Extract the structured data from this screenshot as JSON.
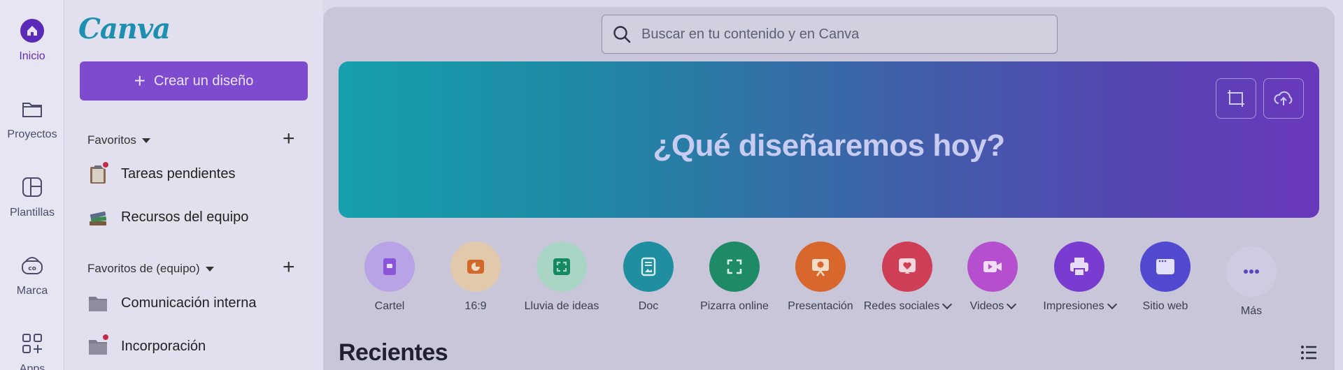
{
  "rail": {
    "items": [
      {
        "label": "Inicio",
        "icon": "home-icon",
        "active": true
      },
      {
        "label": "Proyectos",
        "icon": "folder-icon"
      },
      {
        "label": "Plantillas",
        "icon": "templates-icon"
      },
      {
        "label": "Marca",
        "icon": "brand-icon"
      },
      {
        "label": "Apps",
        "icon": "apps-icon"
      }
    ]
  },
  "sidebar": {
    "logo": "Canva",
    "create_label": "Crear un diseño",
    "favorites": {
      "title": "Favoritos",
      "items": [
        {
          "label": "Tareas pendientes",
          "icon": "clipboard-icon"
        },
        {
          "label": "Recursos del equipo",
          "icon": "books-icon"
        }
      ]
    },
    "team_favorites": {
      "title": "Favoritos de (equipo)",
      "items": [
        {
          "label": "Comunicación interna",
          "icon": "folder-icon"
        },
        {
          "label": "Incorporación",
          "icon": "folder-icon"
        }
      ]
    }
  },
  "main": {
    "search_placeholder": "Buscar en tu contenido y en Canva",
    "banner_title": "¿Qué diseñaremos hoy?",
    "design_types": [
      {
        "label": "Cartel",
        "color": "#b7a3e6",
        "icon": "poster-icon"
      },
      {
        "label": "16:9",
        "color": "#e3c9ab",
        "icon": "pie-icon"
      },
      {
        "label": "Lluvia de ideas",
        "color": "#a9d6c4",
        "icon": "brainstorm-icon"
      },
      {
        "label": "Doc",
        "color": "#1f8ea0",
        "icon": "doc-icon"
      },
      {
        "label": "Pizarra online",
        "color": "#1f8a66",
        "icon": "whiteboard-icon"
      },
      {
        "label": "Presentación",
        "color": "#d7672c",
        "icon": "presentation-icon"
      },
      {
        "label": "Redes sociales",
        "color": "#cf3e57",
        "icon": "heart-icon",
        "dropdown": true
      },
      {
        "label": "Videos",
        "color": "#b64fcd",
        "icon": "video-icon",
        "dropdown": true
      },
      {
        "label": "Impresiones",
        "color": "#7a3bd0",
        "icon": "print-icon",
        "dropdown": true
      },
      {
        "label": "Sitio web",
        "color": "#5149cf",
        "icon": "website-icon"
      },
      {
        "label": "Más",
        "color": "#cfcbe0",
        "icon": "more-icon"
      }
    ],
    "recent_title": "Recientes"
  }
}
